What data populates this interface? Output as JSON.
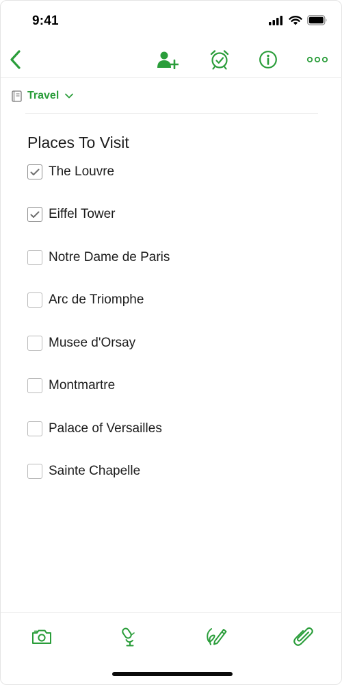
{
  "status_bar": {
    "time": "9:41"
  },
  "nav": {
    "back_icon": "chevron-left-icon",
    "share_icon": "add-person-icon",
    "reminder_icon": "alarm-clock-icon",
    "info_icon": "info-icon",
    "more_icon": "more-dots-icon"
  },
  "notebook": {
    "icon": "notebook-icon",
    "label": "Travel"
  },
  "note": {
    "title": "Places To Visit",
    "items": [
      {
        "label": "The Louvre",
        "checked": true
      },
      {
        "label": "Eiffel Tower",
        "checked": true
      },
      {
        "label": "Notre Dame de Paris",
        "checked": false
      },
      {
        "label": "Arc de Triomphe",
        "checked": false
      },
      {
        "label": "Musee d'Orsay",
        "checked": false
      },
      {
        "label": "Montmartre",
        "checked": false
      },
      {
        "label": "Palace of Versailles",
        "checked": false
      },
      {
        "label": "Sainte Chapelle",
        "checked": false
      }
    ]
  },
  "toolbar": {
    "camera_icon": "camera-icon",
    "audio_icon": "microphone-icon",
    "sketch_icon": "handwriting-pen-icon",
    "attach_icon": "paperclip-icon"
  },
  "colors": {
    "accent": "#2a9d3a",
    "text": "#1b1b1b",
    "divider": "#ececec"
  }
}
